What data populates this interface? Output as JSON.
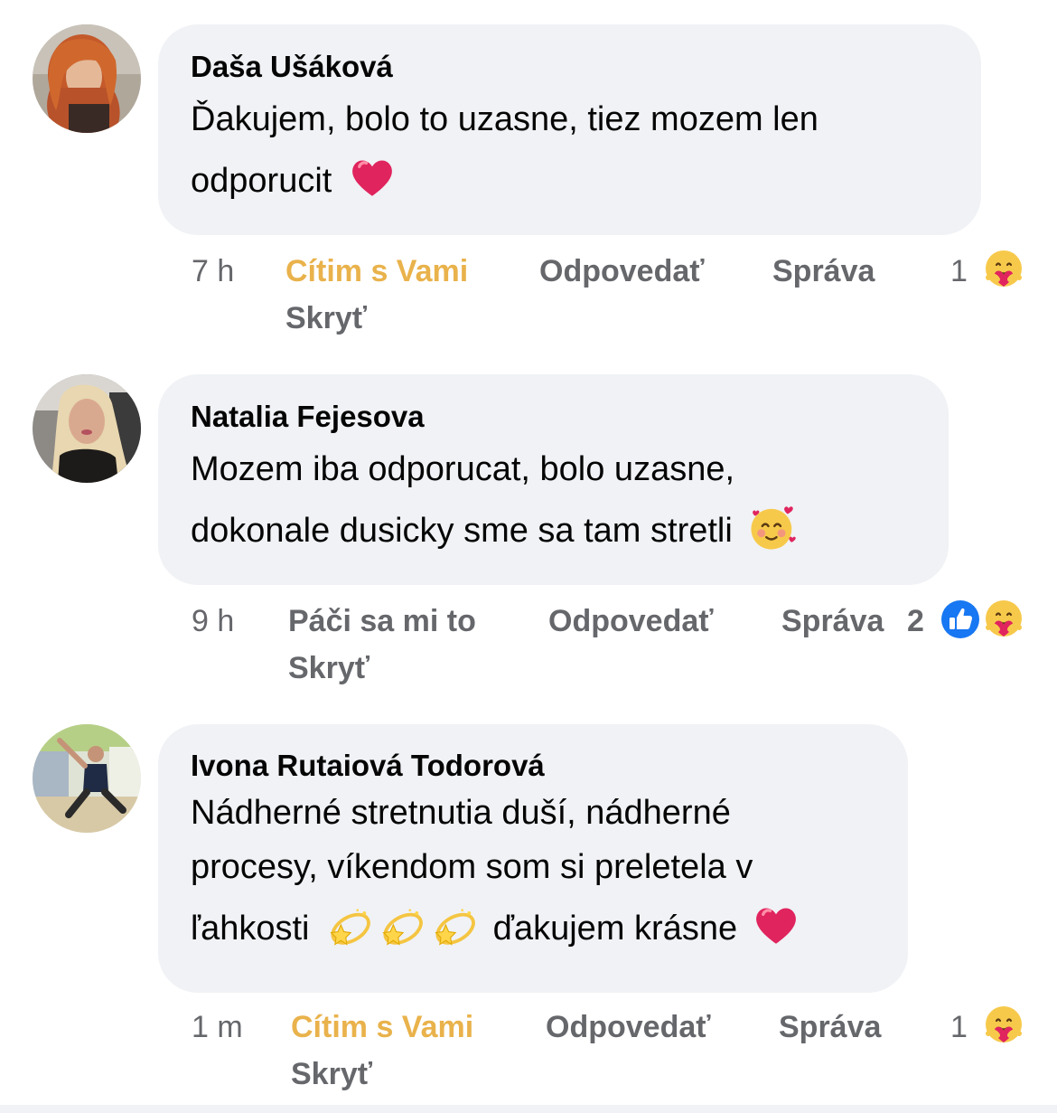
{
  "comments": [
    {
      "author": "Daša Ušáková",
      "text_line1": "Ďakujem, bolo to uzasne, tiez mozem len",
      "text_line2": "odporucit",
      "time": "7 h",
      "reaction_label": "Cítim s Vami",
      "reply": "Odpovedať",
      "message": "Správa",
      "count": "1",
      "hide": "Skryť",
      "reactions": [
        "care-reaction-icon"
      ],
      "emoji_end": "heart-icon"
    },
    {
      "author": "Natalia Fejesova",
      "text_line1": "Mozem iba odporucat, bolo uzasne,",
      "text_line2": "dokonale dusicky sme sa tam stretli",
      "time": "9 h",
      "reaction_label": "Páči sa mi to",
      "reply": "Odpovedať",
      "message": "Správa",
      "count": "2",
      "hide": "Skryť",
      "reactions": [
        "like-reaction-icon",
        "care-reaction-icon"
      ],
      "emoji_end": "smiling-face-with-hearts-icon"
    },
    {
      "author": "Ivona Rutaiová Todorová",
      "text_line1": "Nádherné stretnutia duší, nádherné",
      "text_line2": "procesy, víkendom som si preletela v",
      "text_line3_a": "ľahkosti",
      "text_line3_b": "ďakujem krásne",
      "time": "1 m",
      "reaction_label": "Cítim s Vami",
      "reply": "Odpovedať",
      "message": "Správa",
      "count": "1",
      "hide": "Skryť",
      "reactions": [
        "care-reaction-icon"
      ],
      "emoji_middle": "dizzy-icon",
      "emoji_end": "heart-icon"
    }
  ],
  "colors": {
    "bubble": "#f0f2f5",
    "secondary_text": "#65676b",
    "care_reaction_text": "#e9b24b",
    "like_blue": "#1877f2",
    "heart_red": "#e0245e"
  }
}
